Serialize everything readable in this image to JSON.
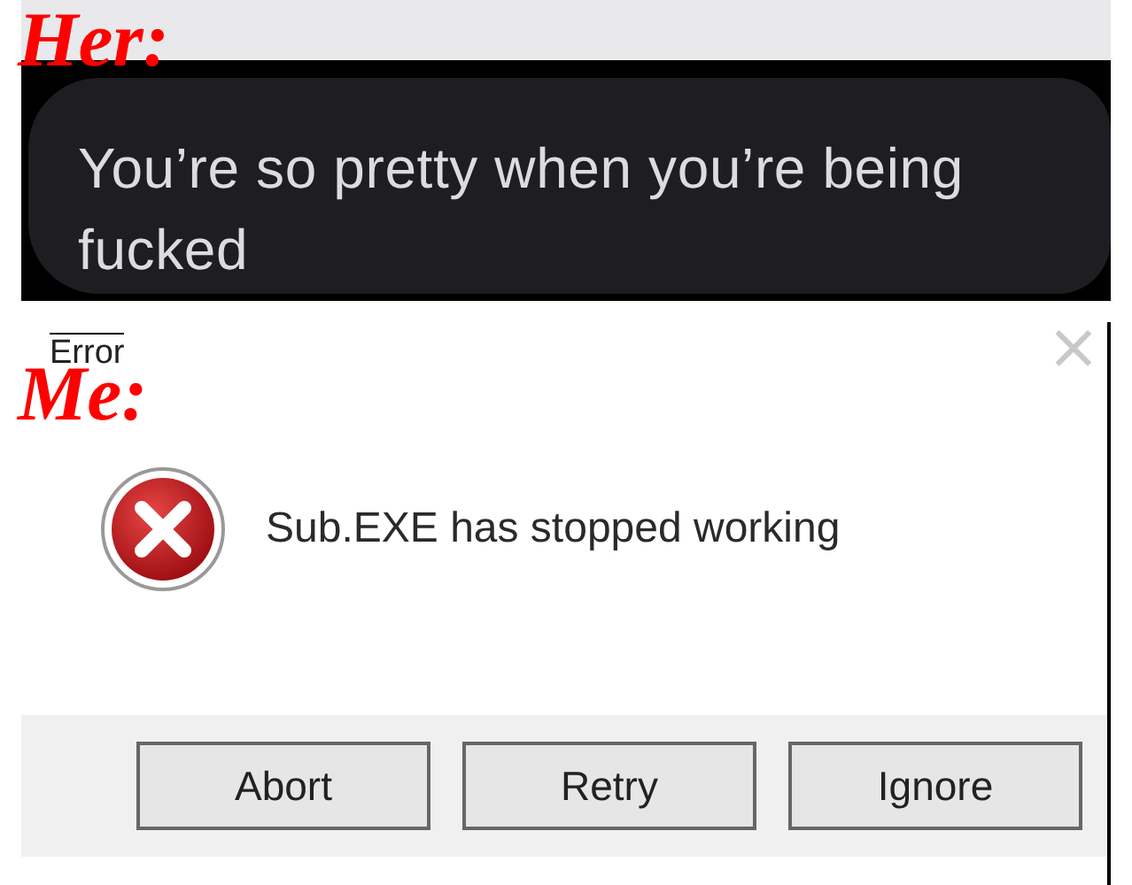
{
  "captions": [
    {
      "text": "Her:"
    },
    {
      "text": "Me:"
    }
  ],
  "chat": {
    "message": "You’re so pretty when you’re being fucked"
  },
  "dialog": {
    "title": "Error",
    "close": "×",
    "message": "Sub.EXE has stopped working",
    "buttons": [
      {
        "label": "Abort"
      },
      {
        "label": "Retry"
      },
      {
        "label": "Ignore"
      }
    ]
  }
}
